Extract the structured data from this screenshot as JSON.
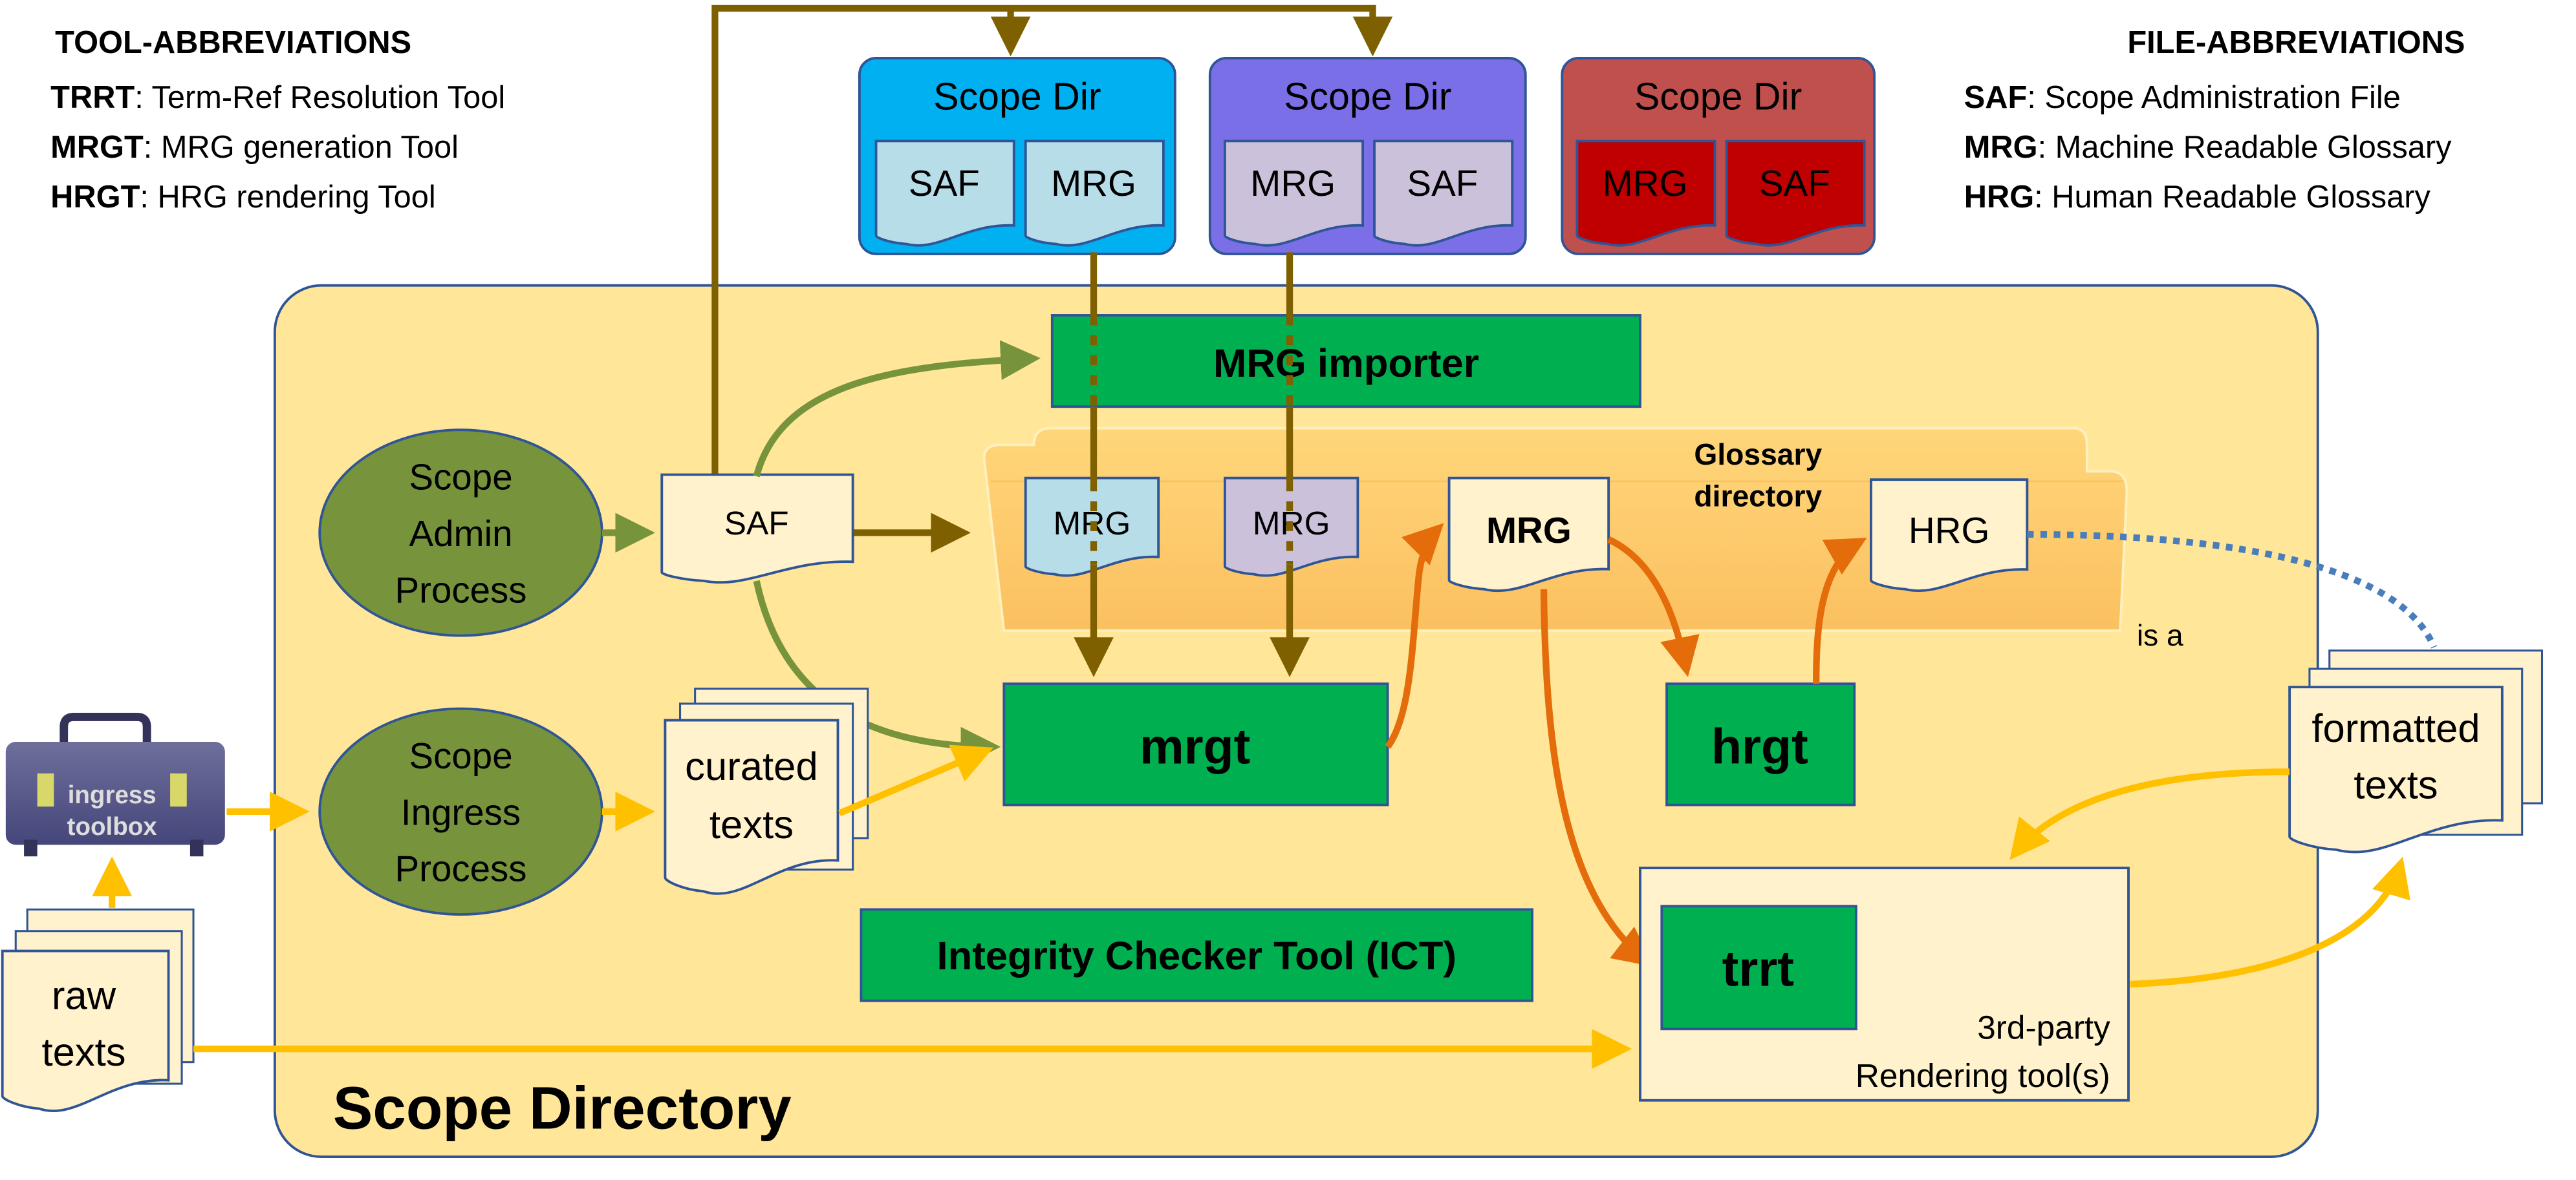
{
  "tool_abbreviations": {
    "title": "TOOL-ABBREVIATIONS",
    "items": [
      {
        "abbr": "TRRT",
        "desc": ": Term-Ref Resolution Tool"
      },
      {
        "abbr": "MRGT",
        "desc": ": MRG generation Tool"
      },
      {
        "abbr": "HRGT",
        "desc": ": HRG rendering Tool"
      }
    ]
  },
  "file_abbreviations": {
    "title": "FILE-ABBREVIATIONS",
    "items": [
      {
        "abbr": "SAF",
        "desc": ": Scope Administration File"
      },
      {
        "abbr": "MRG",
        "desc": ": Machine Readable Glossary"
      },
      {
        "abbr": "HRG",
        "desc": ": Human Readable Glossary"
      }
    ]
  },
  "external_scopes": [
    {
      "title": "Scope Dir",
      "color": "#00B0F0",
      "docs": [
        "SAF",
        "MRG"
      ]
    },
    {
      "title": "Scope Dir",
      "color": "#7B6FE8",
      "docs": [
        "MRG",
        "SAF"
      ]
    },
    {
      "title": "Scope Dir",
      "color": "#C0504D",
      "docs": [
        "MRG",
        "SAF"
      ]
    }
  ],
  "scope_directory": {
    "label": "Scope Directory",
    "mrg_importer": "MRG importer",
    "glossary_directory": [
      "Glossary",
      "directory"
    ],
    "imported_mrgs": [
      "MRG",
      "MRG"
    ],
    "own_mrg": "MRG",
    "hrg": "HRG",
    "saf": "SAF",
    "scope_admin_process": [
      "Scope",
      "Admin",
      "Process"
    ],
    "scope_ingress_process": [
      "Scope",
      "Ingress",
      "Process"
    ],
    "curated_texts": [
      "curated",
      "texts"
    ],
    "mrgt": "mrgt",
    "hrgt": "hrgt",
    "ict": "Integrity Checker Tool (ICT)",
    "rendering_tools": {
      "trrt": "trrt",
      "line1": "3rd-party",
      "line2": "Rendering  tool(s)"
    }
  },
  "ingress_toolbox": [
    "ingress",
    "toolbox"
  ],
  "raw_texts": [
    "raw",
    "texts"
  ],
  "formatted_texts": [
    "formatted",
    "texts"
  ],
  "is_a_label": "is a",
  "colors": {
    "scope_bg": "#FFE699",
    "tool_green": "#00B050",
    "process_green": "#77933C",
    "brown_arrow": "#7F6000",
    "orange_arrow": "#E46C0A",
    "yellow_arrow": "#FFC000",
    "doc_cream": "#FFF2CC"
  }
}
